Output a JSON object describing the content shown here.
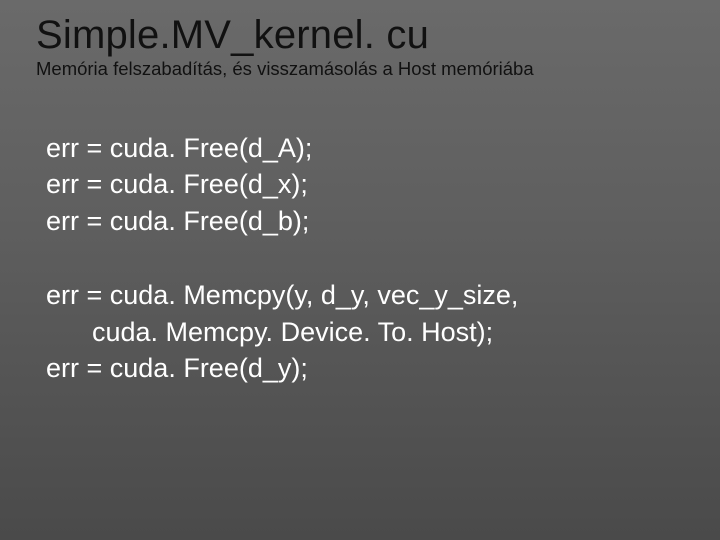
{
  "slide": {
    "title": "Simple.MV_kernel. cu",
    "subtitle": "Memória felszabadítás, és visszamásolás a Host memóriába",
    "code": {
      "line1": "err = cuda. Free(d_A);",
      "line2": "err = cuda. Free(d_x);",
      "line3": "err = cuda. Free(d_b);",
      "line4": "err = cuda. Memcpy(y, d_y, vec_y_size,",
      "line5": "cuda. Memcpy. Device. To. Host);",
      "line6": "err = cuda. Free(d_y);"
    }
  }
}
